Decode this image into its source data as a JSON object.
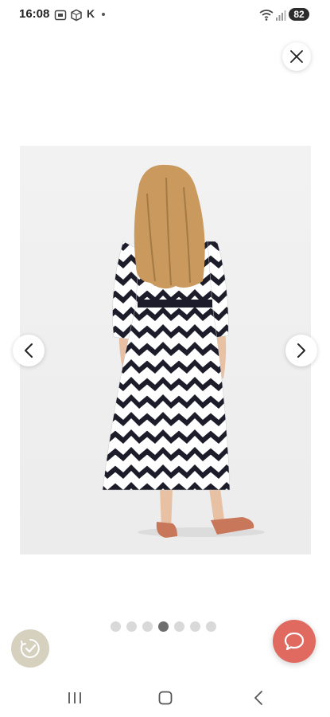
{
  "status_bar": {
    "time": "16:08",
    "letter": "K",
    "battery": "82"
  },
  "gallery": {
    "total_images": 7,
    "active_index": 3
  },
  "colors": {
    "chat_fab": "#e06a5f",
    "timer_badge": "#d6d0bf",
    "dot_active": "#6e6e6e",
    "dot_inactive": "#d9d9d9"
  },
  "icons": {
    "close": "close-icon",
    "prev": "chevron-left-icon",
    "next": "chevron-right-icon",
    "chat": "chat-bubble-icon",
    "timer": "timer-check-icon"
  }
}
